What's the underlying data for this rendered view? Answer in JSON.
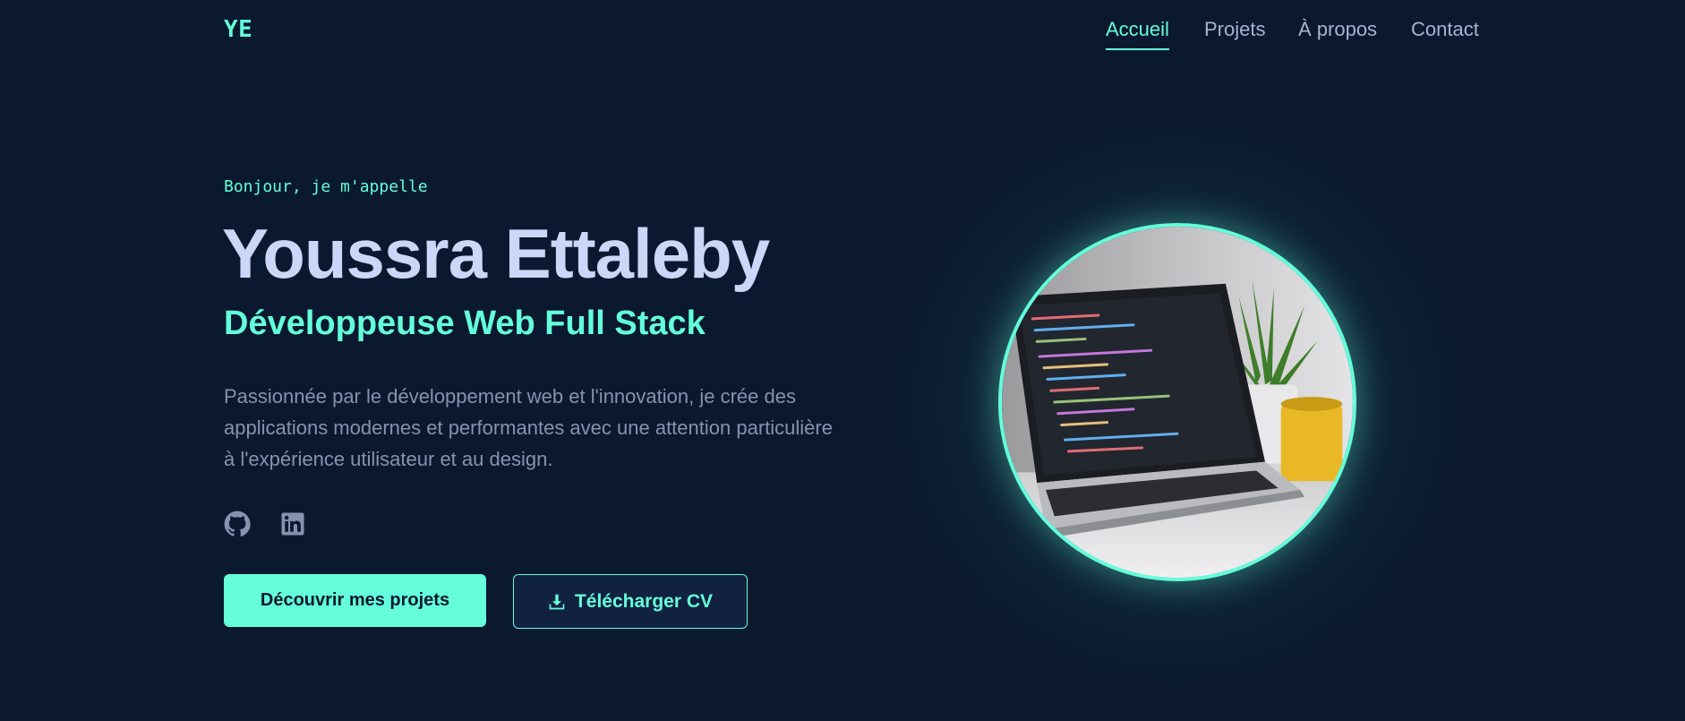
{
  "header": {
    "logo": "YE",
    "nav": [
      {
        "label": "Accueil",
        "active": true
      },
      {
        "label": "Projets",
        "active": false
      },
      {
        "label": "À propos",
        "active": false
      },
      {
        "label": "Contact",
        "active": false
      }
    ]
  },
  "hero": {
    "greeting": "Bonjour, je m'appelle",
    "name": "Youssra Ettaleby",
    "role": "Développeuse Web Full Stack",
    "bio": "Passionnée par le développement web et l'innovation, je crée des applications modernes et performantes avec une attention particulière à l'expérience utilisateur et au design.",
    "socials": [
      {
        "icon": "github-icon"
      },
      {
        "icon": "linkedin-icon"
      }
    ],
    "primary_button": "Découvrir mes projets",
    "secondary_button": "Télécharger CV",
    "photo_icon": "laptop-code-photo"
  },
  "colors": {
    "background": "#0a192f",
    "accent": "#64ffda",
    "heading": "#ccd6f6",
    "text": "#8892b0"
  }
}
